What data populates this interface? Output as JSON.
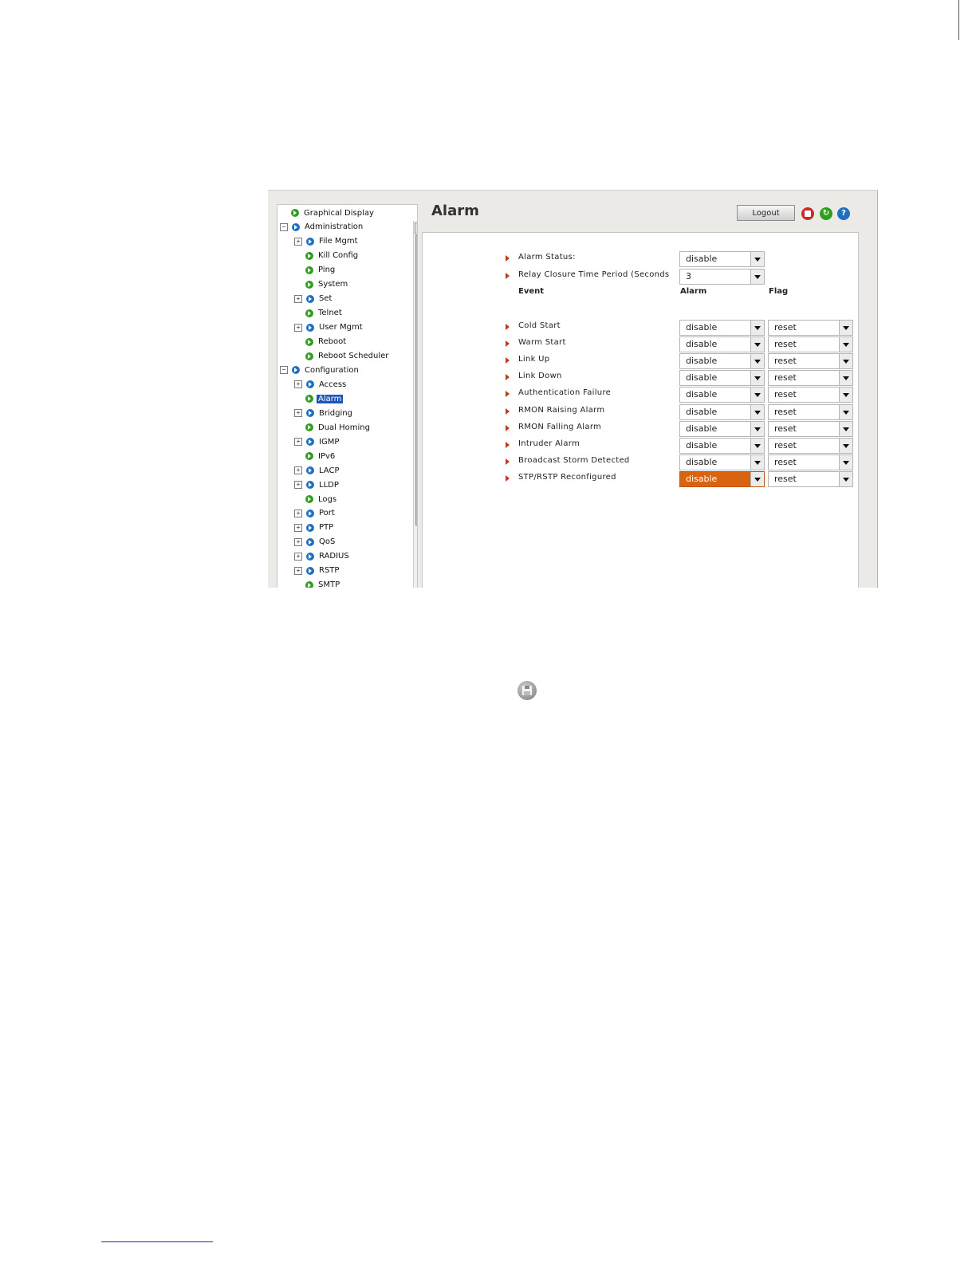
{
  "page": {
    "title": "Alarm",
    "logout_label": "Logout"
  },
  "header_icons": [
    "save-icon",
    "refresh-icon",
    "help-icon"
  ],
  "nav": {
    "items": [
      {
        "label": "Graphical Display",
        "icon": "green"
      },
      {
        "label": "Administration",
        "icon": "blue",
        "expander": "−"
      },
      {
        "label": "File Mgmt",
        "icon": "blue",
        "expander": "+"
      },
      {
        "label": "Kill Config",
        "icon": "green"
      },
      {
        "label": "Ping",
        "icon": "green"
      },
      {
        "label": "System",
        "icon": "green"
      },
      {
        "label": "Set",
        "icon": "blue",
        "expander": "+"
      },
      {
        "label": "Telnet",
        "icon": "green"
      },
      {
        "label": "User Mgmt",
        "icon": "blue",
        "expander": "+"
      },
      {
        "label": "Reboot",
        "icon": "green"
      },
      {
        "label": "Reboot Scheduler",
        "icon": "green"
      },
      {
        "label": "Configuration",
        "icon": "blue",
        "expander": "−"
      },
      {
        "label": "Access",
        "icon": "blue",
        "expander": "+"
      },
      {
        "label": "Alarm",
        "icon": "green",
        "selected": true
      },
      {
        "label": "Bridging",
        "icon": "blue",
        "expander": "+"
      },
      {
        "label": "Dual Homing",
        "icon": "green"
      },
      {
        "label": "IGMP",
        "icon": "blue",
        "expander": "+"
      },
      {
        "label": "IPv6",
        "icon": "green"
      },
      {
        "label": "LACP",
        "icon": "blue",
        "expander": "+"
      },
      {
        "label": "LLDP",
        "icon": "blue",
        "expander": "+"
      },
      {
        "label": "Logs",
        "icon": "green"
      },
      {
        "label": "Port",
        "icon": "blue",
        "expander": "+"
      },
      {
        "label": "PTP",
        "icon": "blue",
        "expander": "+"
      },
      {
        "label": "QoS",
        "icon": "blue",
        "expander": "+"
      },
      {
        "label": "RADIUS",
        "icon": "blue",
        "expander": "+"
      },
      {
        "label": "RSTP",
        "icon": "blue",
        "expander": "+"
      },
      {
        "label": "SMTP",
        "icon": "green"
      }
    ]
  },
  "settings": {
    "alarm_status": {
      "label": "Alarm Status:",
      "value": "disable"
    },
    "relay_closure": {
      "label": "Relay Closure Time Period (Seconds",
      "value": "3"
    }
  },
  "columns": {
    "event": "Event",
    "alarm": "Alarm",
    "flag": "Flag"
  },
  "events": [
    {
      "label": "Cold Start",
      "alarm": "disable",
      "flag": "reset"
    },
    {
      "label": "Warm Start",
      "alarm": "disable",
      "flag": "reset"
    },
    {
      "label": "Link Up",
      "alarm": "disable",
      "flag": "reset"
    },
    {
      "label": "Link Down",
      "alarm": "disable",
      "flag": "reset"
    },
    {
      "label": "Authentication Failure",
      "alarm": "disable",
      "flag": "reset"
    },
    {
      "label": "RMON Raising Alarm",
      "alarm": "disable",
      "flag": "reset"
    },
    {
      "label": "RMON Falling Alarm",
      "alarm": "disable",
      "flag": "reset"
    },
    {
      "label": "Intruder Alarm",
      "alarm": "disable",
      "flag": "reset"
    },
    {
      "label": "Broadcast Storm Detected",
      "alarm": "disable",
      "flag": "reset"
    },
    {
      "label": "STP/RSTP Reconfigured",
      "alarm": "disable",
      "flag": "reset",
      "highlight": true
    }
  ],
  "colors": {
    "selected_nav": "#1e56b8",
    "highlight_select": "#d9630f",
    "row_arrow": "#c03a1c"
  }
}
